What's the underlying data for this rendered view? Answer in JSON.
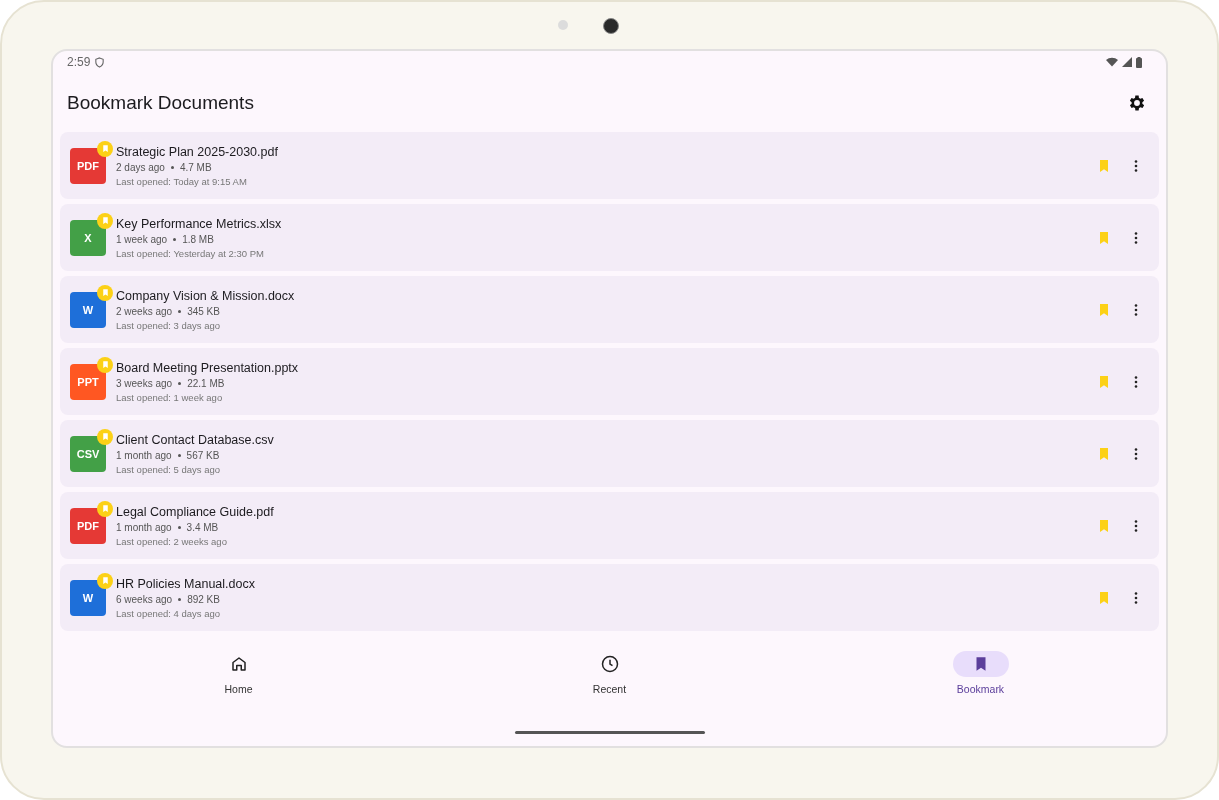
{
  "status_bar": {
    "time": "2:59"
  },
  "header": {
    "title": "Bookmark Documents"
  },
  "documents": [
    {
      "badge": "PDF",
      "color": "#e53935",
      "name": "Strategic Plan 2025-2030.pdf",
      "age": "2 days ago",
      "size": "4.7 MB",
      "last_opened": "Last opened: Today at 9:15 AM",
      "bookmarked": true
    },
    {
      "badge": "X",
      "color": "#43a047",
      "name": "Key Performance Metrics.xlsx",
      "age": "1 week ago",
      "size": "1.8 MB",
      "last_opened": "Last opened: Yesterday at 2:30 PM",
      "bookmarked": true
    },
    {
      "badge": "W",
      "color": "#1e6fd9",
      "name": "Company Vision & Mission.docx",
      "age": "2 weeks ago",
      "size": "345 KB",
      "last_opened": "Last opened: 3 days ago",
      "bookmarked": true
    },
    {
      "badge": "PPT",
      "color": "#ff5722",
      "name": "Board Meeting Presentation.pptx",
      "age": "3 weeks ago",
      "size": "22.1 MB",
      "last_opened": "Last opened: 1 week ago",
      "bookmarked": true
    },
    {
      "badge": "CSV",
      "color": "#43a047",
      "name": "Client Contact Database.csv",
      "age": "1 month ago",
      "size": "567 KB",
      "last_opened": "Last opened: 5 days ago",
      "bookmarked": true
    },
    {
      "badge": "PDF",
      "color": "#e53935",
      "name": "Legal Compliance Guide.pdf",
      "age": "1 month ago",
      "size": "3.4 MB",
      "last_opened": "Last opened: 2 weeks ago",
      "bookmarked": true
    },
    {
      "badge": "W",
      "color": "#1e6fd9",
      "name": "HR Policies Manual.docx",
      "age": "6 weeks ago",
      "size": "892 KB",
      "last_opened": "Last opened: 4 days ago",
      "bookmarked": true
    }
  ],
  "nav": [
    {
      "kind": "home",
      "label": "Home",
      "selected": false
    },
    {
      "kind": "recent",
      "label": "Recent",
      "selected": false
    },
    {
      "kind": "bookmark",
      "label": "Bookmark",
      "selected": true
    }
  ]
}
